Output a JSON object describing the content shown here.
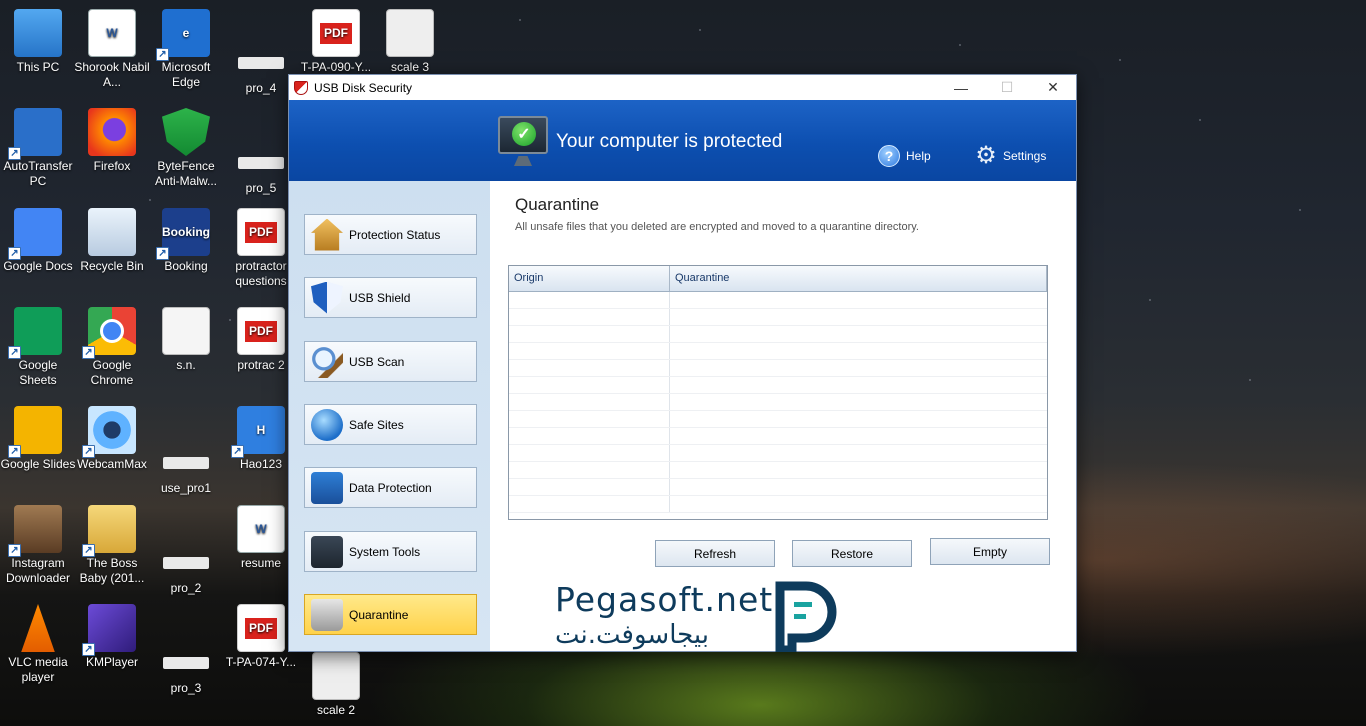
{
  "desktop": {
    "icons": [
      {
        "label": "This PC",
        "icon": "this-pc-icon"
      },
      {
        "label": "Shorook Nabil A...",
        "icon": "word-document-icon"
      },
      {
        "label": "Microsoft Edge",
        "icon": "edge-icon"
      },
      {
        "label": "pro_4",
        "icon": "file-icon"
      },
      {
        "label": "T-PA-090-Y...",
        "icon": "pdf-icon"
      },
      {
        "label": "scale 3",
        "icon": "scale-icon"
      },
      {
        "label": "AutoTransfer PC",
        "icon": "autotransfer-icon"
      },
      {
        "label": "Firefox",
        "icon": "firefox-icon"
      },
      {
        "label": "ByteFence Anti-Malw...",
        "icon": "bytefence-icon"
      },
      {
        "label": "pro_5",
        "icon": "file-icon"
      },
      {
        "label": "Google Docs",
        "icon": "google-docs-icon"
      },
      {
        "label": "Recycle Bin",
        "icon": "recycle-bin-icon"
      },
      {
        "label": "Booking",
        "icon": "booking-icon"
      },
      {
        "label": "protractor questions",
        "icon": "pdf-icon"
      },
      {
        "label": "Google Sheets",
        "icon": "google-sheets-icon"
      },
      {
        "label": "Google Chrome",
        "icon": "chrome-icon"
      },
      {
        "label": "s.n.",
        "icon": "text-document-icon"
      },
      {
        "label": "protrac 2",
        "icon": "pdf-icon"
      },
      {
        "label": "Google Slides",
        "icon": "google-slides-icon"
      },
      {
        "label": "WebcamMax",
        "icon": "webcammax-icon"
      },
      {
        "label": "use_pro1",
        "icon": "file-icon"
      },
      {
        "label": "Hao123",
        "icon": "hao123-icon"
      },
      {
        "label": "Instagram Downloader",
        "icon": "instagram-downloader-icon"
      },
      {
        "label": "The Boss Baby (201...",
        "icon": "folder-icon"
      },
      {
        "label": "pro_2",
        "icon": "file-icon"
      },
      {
        "label": "resume",
        "icon": "word-document-icon"
      },
      {
        "label": "VLC media player",
        "icon": "vlc-icon"
      },
      {
        "label": "KMPlayer",
        "icon": "kmplayer-icon"
      },
      {
        "label": "pro_3",
        "icon": "file-icon"
      },
      {
        "label": "T-PA-074-Y...",
        "icon": "pdf-icon"
      },
      {
        "label": "scale 2",
        "icon": "scale-icon"
      }
    ],
    "booking_glyph": "Booking",
    "pdf_glyph": "PDF"
  },
  "window": {
    "title": "USB Disk Security",
    "status": "Your computer is protected",
    "help_label": "Help",
    "settings_label": "Settings",
    "nav": [
      {
        "label": "Protection Status",
        "icon": "home-icon"
      },
      {
        "label": "USB Shield",
        "icon": "shield-icon"
      },
      {
        "label": "USB Scan",
        "icon": "magnifier-icon"
      },
      {
        "label": "Safe Sites",
        "icon": "globe-icon"
      },
      {
        "label": "Data Protection",
        "icon": "data-lock-icon"
      },
      {
        "label": "System Tools",
        "icon": "system-tools-icon"
      },
      {
        "label": "Quarantine",
        "icon": "trash-bin-icon",
        "active": true
      }
    ],
    "main": {
      "title": "Quarantine",
      "description": "All unsafe files that you deleted are encrypted and moved to a quarantine directory.",
      "columns": [
        "Origin",
        "Quarantine"
      ],
      "rows": [],
      "buttons": {
        "refresh": "Refresh",
        "restore": "Restore",
        "empty": "Empty"
      }
    }
  },
  "watermark": {
    "latin": "Pegasoft.net",
    "arabic": "بيجاسوفت.نت"
  },
  "colors": {
    "header_blue": "#0d4fb0",
    "sidebar_bg": "#cddff0",
    "active_nav": "#ffd24a",
    "watermark": "#0e3b5c"
  }
}
